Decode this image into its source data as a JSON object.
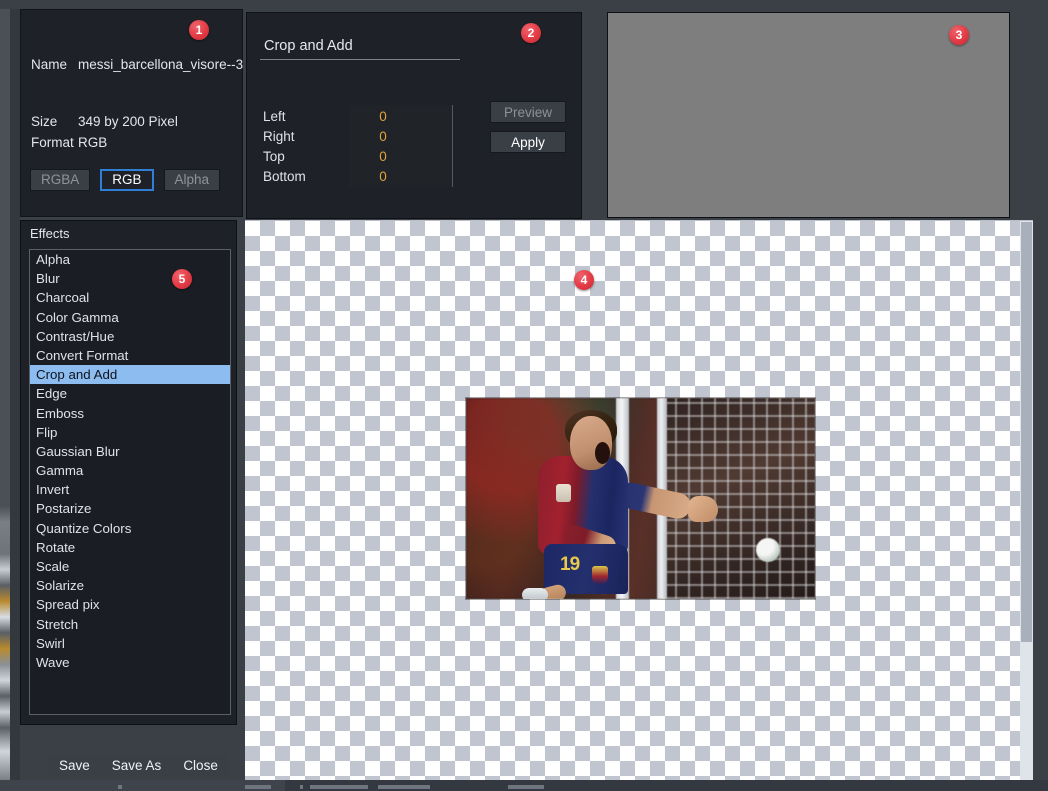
{
  "window": {
    "background_color": "#3b3f46",
    "panel_color": "#1e2228"
  },
  "info_panel": {
    "name_label": "Name",
    "name_value": "messi_barcellona_visore--3",
    "size_label": "Size",
    "size_value": "349 by 200 Pixel",
    "format_label": "Format",
    "format_value": "RGB",
    "format_buttons": [
      {
        "label": "RGBA",
        "state": "disabled"
      },
      {
        "label": "RGB",
        "state": "selected"
      },
      {
        "label": "Alpha",
        "state": "disabled"
      }
    ],
    "selected_accent": "#2f7fd6",
    "badge": "1"
  },
  "crop_panel": {
    "title": "Crop and Add",
    "badge": "2",
    "value_color": "#e2a33a",
    "fields": [
      {
        "label": "Left",
        "value": "0"
      },
      {
        "label": "Right",
        "value": "0"
      },
      {
        "label": "Top",
        "value": "0"
      },
      {
        "label": "Bottom",
        "value": "0"
      }
    ],
    "spinner_icons": [
      "spinner-up-icon",
      "spinner-down-icon",
      "reset-circular-arrow-icon"
    ],
    "buttons": [
      {
        "label": "Preview",
        "state": "disabled"
      },
      {
        "label": "Apply",
        "state": "enabled"
      }
    ]
  },
  "preview_panel": {
    "badge": "3",
    "fill_color": "#7e7e7e"
  },
  "effects_panel": {
    "title": "Effects",
    "badge": "5",
    "selected": "Crop and Add",
    "highlight_color": "#8cbcf0",
    "items": [
      "Alpha",
      "Blur",
      "Charcoal",
      "Color Gamma",
      "Contrast/Hue",
      "Convert Format",
      "Crop and Add",
      "Edge",
      "Emboss",
      "Flip",
      "Gaussian Blur",
      "Gamma",
      "Invert",
      "Postarize",
      "Quantize Colors",
      "Rotate",
      "Scale",
      "Solarize",
      "Spread pix",
      "Stretch",
      "Swirl",
      "Wave"
    ]
  },
  "footer": {
    "buttons": [
      "Save",
      "Save As",
      "Close"
    ]
  },
  "canvas_panel": {
    "badge": "4",
    "checker_light": "#ffffff",
    "checker_dark": "#c0c5cf",
    "checker_size_px": "15",
    "image_alt": "messi_barcellona_visore--3",
    "image_width": "349",
    "image_height": "200",
    "jersey_number": "19"
  }
}
